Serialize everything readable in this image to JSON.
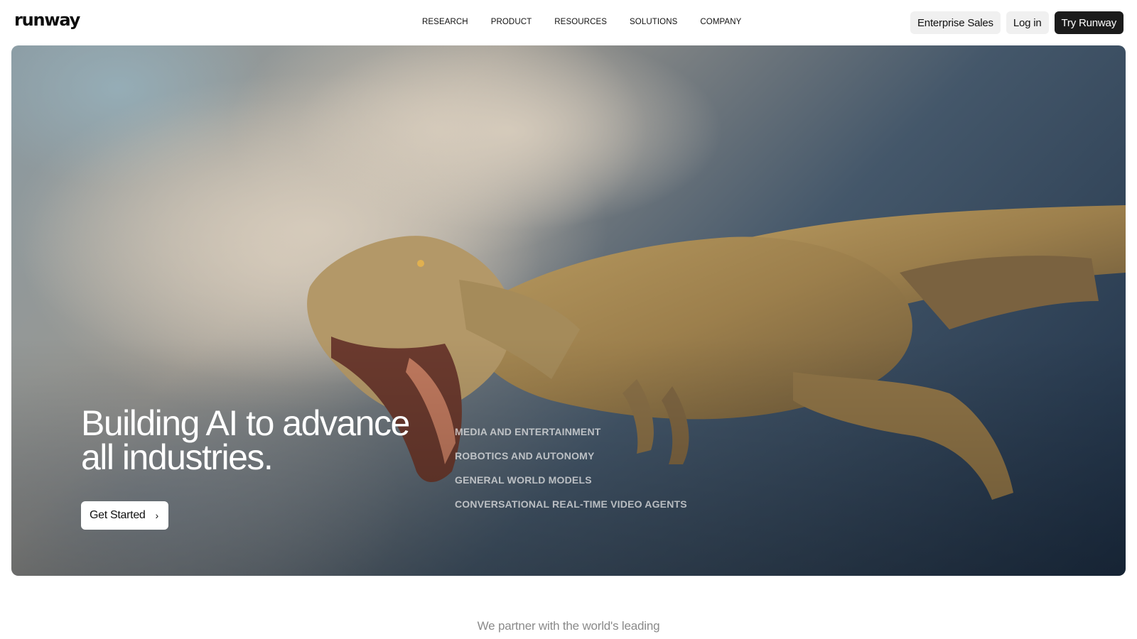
{
  "brand": {
    "logo_text": "runway"
  },
  "nav": {
    "items": [
      {
        "label": "RESEARCH"
      },
      {
        "label": "PRODUCT"
      },
      {
        "label": "RESOURCES"
      },
      {
        "label": "SOLUTIONS"
      },
      {
        "label": "COMPANY"
      }
    ]
  },
  "header_actions": {
    "enterprise_label": "Enterprise Sales",
    "login_label": "Log in",
    "try_label": "Try Runway"
  },
  "hero": {
    "title_line1": "Building AI to advance",
    "title_line2": "all industries.",
    "cta_label": "Get Started",
    "cta_icon": "chevron-right-icon",
    "industries": [
      {
        "label": "MEDIA AND ENTERTAINMENT"
      },
      {
        "label": "ROBOTICS AND AUTONOMY"
      },
      {
        "label": "GENERAL WORLD MODELS"
      },
      {
        "label": "CONVERSATIONAL REAL-TIME VIDEO AGENTS"
      }
    ]
  },
  "partner": {
    "text": "We partner with the world's leading"
  },
  "colors": {
    "dark_button": "#1b1b1b",
    "light_button": "#f0f0f0",
    "muted_text": "#8a8a8a"
  }
}
